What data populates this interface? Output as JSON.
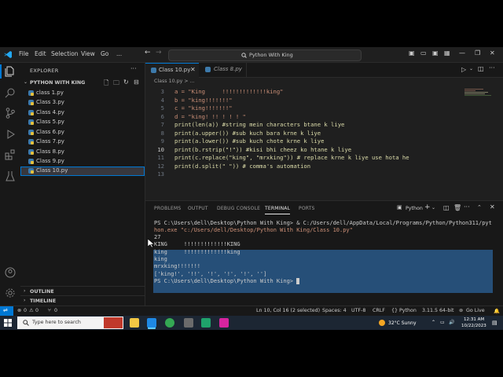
{
  "menu": [
    "File",
    "Edit",
    "Selection",
    "View",
    "Go",
    "..."
  ],
  "window": {
    "search_text": "Python With King"
  },
  "sidebar": {
    "title": "EXPLORER",
    "folder": "PYTHON WITH KING",
    "files": [
      "class 1.py",
      "Class 3.py",
      "Class 4.py",
      "Class 5.py",
      "Class 6.py",
      "Class 7.py",
      "Class 8.py",
      "Class 9.py",
      "Class 10.py"
    ],
    "outline": "OUTLINE",
    "timeline": "TIMELINE"
  },
  "tabs": [
    "Class 10.py",
    "Class 8.py"
  ],
  "breadcrumb": "Class 10.py > ...",
  "editor": {
    "line_numbers": [
      "3",
      "4",
      "5",
      "6",
      "7",
      "8",
      "9",
      "10",
      "11",
      "12",
      "13"
    ],
    "lines": [
      "a = \"King     !!!!!!!!!!!!!king\"",
      "b = \"king!!!!!!!\"",
      "c = \"king!!!!!!!\"",
      "d = \"king! !! ! ! ! \"",
      "print(len(a)) #string mein characters btane k liye",
      "print(a.upper()) #sub kuch bara krne k liye",
      "print(a.lower()) #sub kuch chote krne k liye",
      "print(b.rstrip(\"!\")) #kisi bhi cheez ko htane k liye",
      "print(c.replace(\"king\", \"mrxking\")) # replace krne k liye use hota he",
      "print(d.split(\" \")) # comma's automation",
      ""
    ]
  },
  "panel": {
    "tabs": [
      "PROBLEMS",
      "OUTPUT",
      "DEBUG CONSOLE",
      "TERMINAL",
      "PORTS"
    ],
    "shell_label": "Python",
    "terminal_lines": [
      "PS C:\\Users\\dell\\Desktop\\Python With King> & C:/Users/dell/AppData/Local/Programs/Python/Python311/pyt",
      "hon.exe \"c:/Users/dell/Desktop/Python With King/Class 10.py\"",
      "27",
      "KING     !!!!!!!!!!!!!KING",
      "king     !!!!!!!!!!!!!king",
      "king",
      "mrxking!!!!!!!",
      "['king!', '!!', '!', '!', '!', '']",
      "PS C:\\Users\\dell\\Desktop\\Python With King> "
    ]
  },
  "status": {
    "left": [
      "0",
      "0",
      "0"
    ],
    "position": "Ln 10, Col 16 (2 selected)",
    "spaces": "Spaces: 4",
    "encoding": "UTF-8",
    "eol": "CRLF",
    "language": "Python",
    "interpreter": "3.11.5 64-bit",
    "golive": "Go Live"
  },
  "taskbar": {
    "search_placeholder": "Type here to search",
    "weather": "32°C  Sunny",
    "time": "12:31 AM",
    "date": "10/22/2023"
  },
  "colors": {
    "accent": "#0078d4",
    "selection": "#264f78",
    "bg": "#1f1f1f"
  }
}
